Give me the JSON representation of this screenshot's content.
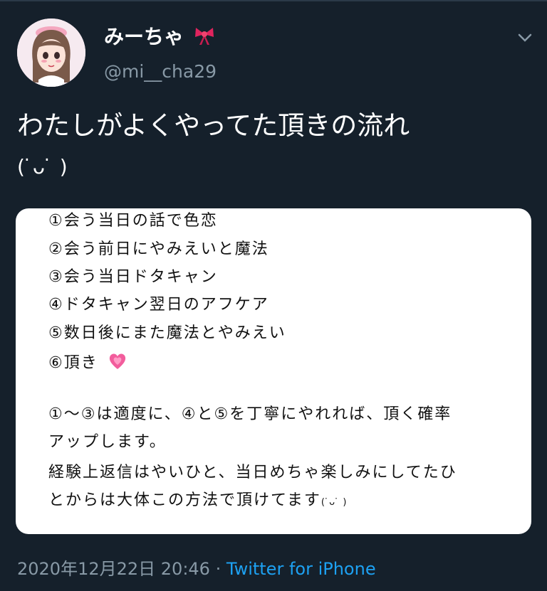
{
  "tweet": {
    "author_name": "みーちゃ",
    "author_handle": "@mi__cha29",
    "text_line1": "わたしがよくやってた頂きの流れ",
    "text_line2": "(  ̇ᴗ ̇ )",
    "timestamp": "2020年12月22日 20:46",
    "separator": "·",
    "source": "Twitter for iPhone"
  },
  "card": {
    "items": [
      "①会う当日の話で色恋",
      "②会う前日にやみえいと魔法",
      "③会う当日ドタキャン",
      "④ドタキャン翌日のアフケア",
      "⑤数日後にまた魔法とやみえい",
      "⑥頂き"
    ],
    "notes": [
      "①〜③は適度に、④と⑤を丁寧にやれれば、頂く確率",
      "アップします。",
      "経験上返信はやいひと、当日めちゃ楽しみにしてたひ",
      "とからは大体この方法で頂けてます"
    ],
    "note_kao": "(  ̇ᴗ ̇ )"
  },
  "icons": {
    "bow": "ribbon-bow-icon",
    "heart": "growing-heart-icon",
    "menu": "chevron-down-icon"
  },
  "colors": {
    "background": "#15202b",
    "secondary_text": "#8899a6",
    "link": "#1da1f2",
    "card": "#ffffff"
  }
}
